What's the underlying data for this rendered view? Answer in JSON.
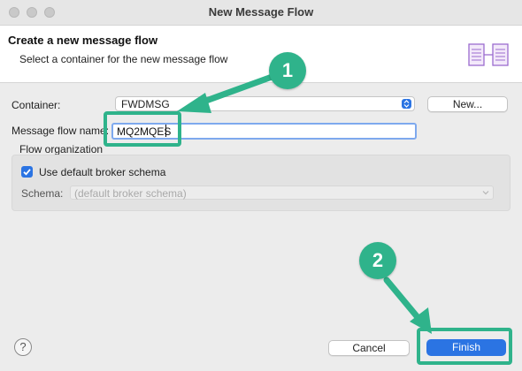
{
  "window": {
    "title": "New Message Flow"
  },
  "banner": {
    "title": "Create a new message flow",
    "subtitle": "Select a container for the new message flow",
    "icon": "message-flow-icon"
  },
  "form": {
    "container_label": "Container:",
    "container_value": "FWDMSG",
    "new_button": "New...",
    "name_label": "Message flow name:",
    "name_value": "MQ2MQES",
    "flow_org_label": "Flow organization",
    "use_default_label": "Use default broker schema",
    "use_default_checked": true,
    "schema_label": "Schema:",
    "schema_value": "(default broker schema)"
  },
  "footer": {
    "help_icon": "help-icon",
    "help_glyph": "?",
    "cancel_button": "Cancel",
    "finish_button": "Finish"
  },
  "annotations": {
    "step1": "1",
    "step2": "2",
    "color": "#2fb38b"
  },
  "colors": {
    "accent": "#2b74e3",
    "annotation": "#2fb38b"
  }
}
